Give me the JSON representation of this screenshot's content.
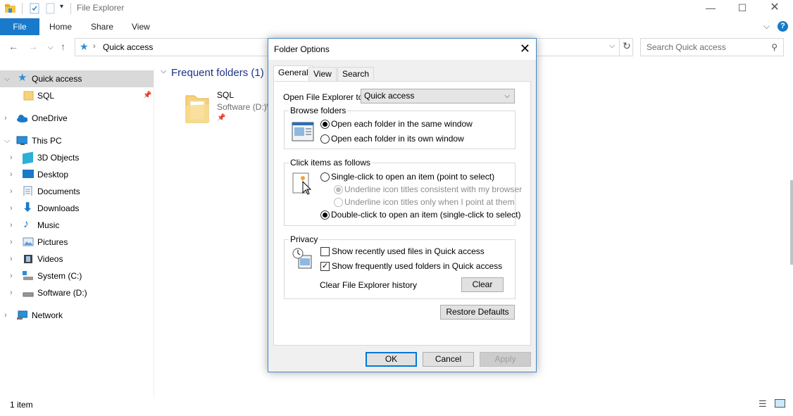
{
  "window": {
    "title": "File Explorer",
    "ribbon_tabs": [
      "File",
      "Home",
      "Share",
      "View"
    ]
  },
  "address": {
    "current": "Quick access"
  },
  "search": {
    "placeholder": "Search Quick access"
  },
  "sidebar": {
    "quick_access": "Quick access",
    "pinned": "SQL",
    "onedrive": "OneDrive",
    "this_pc": "This PC",
    "pc_items": [
      "3D Objects",
      "Desktop",
      "Documents",
      "Downloads",
      "Music",
      "Pictures",
      "Videos",
      "System (C:)",
      "Software (D:)"
    ],
    "network": "Network"
  },
  "content": {
    "section_title": "Frequent folders (1)",
    "folder": {
      "name": "SQL",
      "location": "Software (D:)\\"
    }
  },
  "status": {
    "items": "1 item"
  },
  "dialog": {
    "title": "Folder Options",
    "tabs": [
      "General",
      "View",
      "Search"
    ],
    "open_to_label": "Open File Explorer to:",
    "open_to_value": "Quick access",
    "browse": {
      "legend": "Browse folders",
      "same_window": "Open each folder in the same window",
      "own_window": "Open each folder in its own window"
    },
    "click": {
      "legend": "Click items as follows",
      "single": "Single-click to open an item (point to select)",
      "underline_browser": "Underline icon titles consistent with my browser",
      "underline_point": "Underline icon titles only when I point at them",
      "double": "Double-click to open an item (single-click to select)"
    },
    "privacy": {
      "legend": "Privacy",
      "recent_files": "Show recently used files in Quick access",
      "frequent_folders": "Show frequently used folders in Quick access",
      "clear_history": "Clear File Explorer history",
      "clear_button": "Clear"
    },
    "restore_defaults": "Restore Defaults",
    "ok": "OK",
    "cancel": "Cancel",
    "apply": "Apply"
  },
  "colors": {
    "accent": "#1979ca",
    "selection": "#cce8ff",
    "dialog_border": "#4a86c8"
  }
}
